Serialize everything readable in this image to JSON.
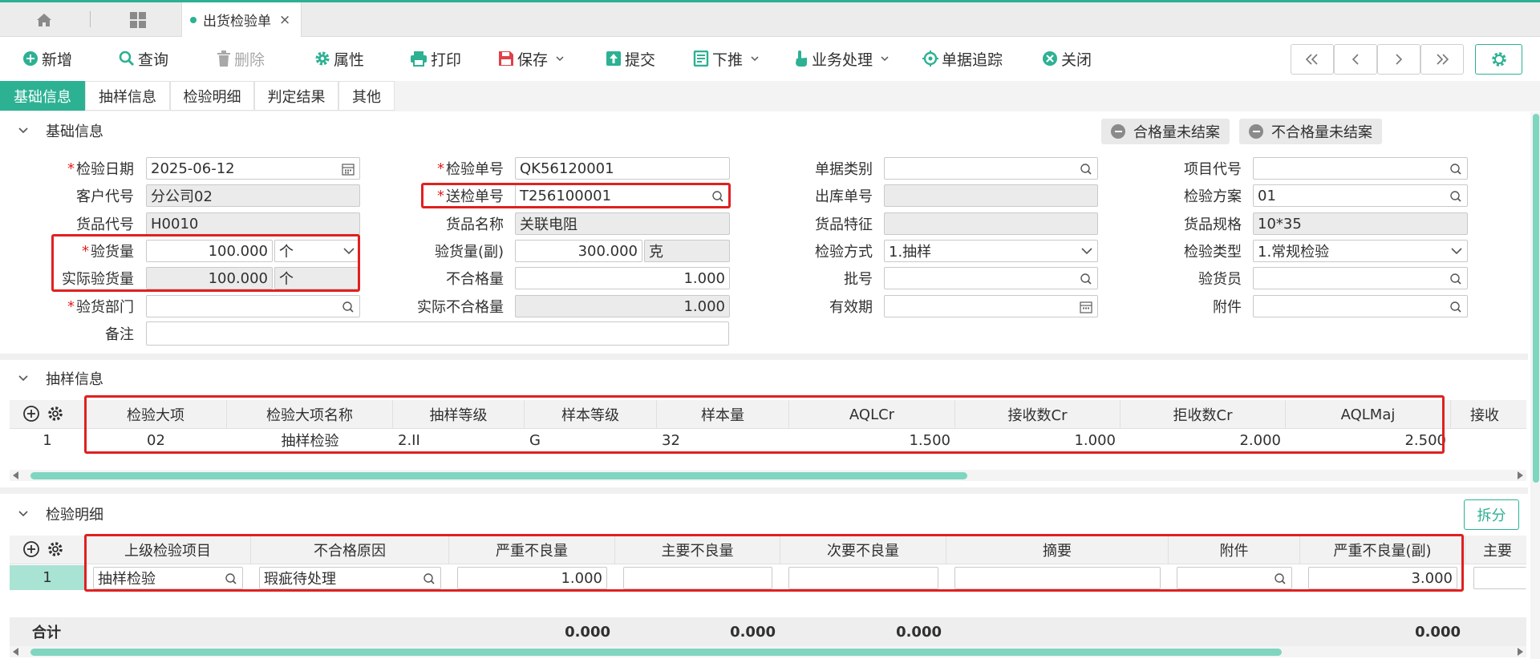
{
  "colors": {
    "accent": "#2cb193",
    "highlight": "#e02020",
    "selected_row": "#a8e3d3"
  },
  "tabs": {
    "doc_tab": "出货检验单",
    "close": "×"
  },
  "toolbar": {
    "new": "新增",
    "query": "查询",
    "delete": "删除",
    "props": "属性",
    "print": "打印",
    "save": "保存",
    "submit": "提交",
    "push_down": "下推",
    "business": "业务处理",
    "trace": "单据追踪",
    "close": "关闭"
  },
  "subtabs": [
    "基础信息",
    "抽样信息",
    "检验明细",
    "判定结果",
    "其他"
  ],
  "basic": {
    "section_title": "基础信息",
    "btn_pass_open": "合格量未结案",
    "btn_fail_open": "不合格量未结案",
    "required_mark": "*",
    "labels": {
      "inspect_date": "检验日期",
      "customer_code": "客户代号",
      "goods_code": "货品代号",
      "inspect_qty": "验货量",
      "actual_qty": "实际验货量",
      "dept": "验货部门",
      "remark": "备注",
      "inspect_no": "检验单号",
      "send_no": "送检单号",
      "goods_name": "货品名称",
      "qty_aux": "验货量(副)",
      "fail_qty": "不合格量",
      "actual_fail_qty": "实际不合格量",
      "doc_type": "单据类别",
      "outbound_no": "出库单号",
      "goods_feature": "货品特征",
      "inspect_method": "检验方式",
      "batch_no": "批号",
      "valid_date": "有效期",
      "project_code": "项目代号",
      "plan": "检验方案",
      "spec": "货品规格",
      "inspect_type": "检验类型",
      "inspector": "验货员",
      "attachment": "附件"
    },
    "values": {
      "inspect_date": "2025-06-12",
      "customer_code": "分公司02",
      "goods_code": "H0010",
      "inspect_qty": "100.000",
      "inspect_unit": "个",
      "actual_qty": "100.000",
      "actual_unit": "个",
      "dept": "",
      "remark": "",
      "inspect_no": "QK56120001",
      "send_no": "T256100001",
      "goods_name": "关联电阻",
      "qty_aux": "300.000",
      "aux_unit": "克",
      "fail_qty": "1.000",
      "actual_fail_qty": "1.000",
      "doc_type": "",
      "outbound_no": "",
      "goods_feature": "",
      "inspect_method": "1.抽样",
      "batch_no": "",
      "valid_date": "",
      "project_code": "",
      "plan": "01",
      "spec": "10*35",
      "inspect_type": "1.常规检验",
      "inspector": "",
      "attachment": ""
    }
  },
  "sampling": {
    "section_title": "抽样信息",
    "columns": [
      "检验大项",
      "检验大项名称",
      "抽样等级",
      "样本等级",
      "样本量",
      "AQLCr",
      "接收数Cr",
      "拒收数Cr",
      "AQLMaj",
      "接收"
    ],
    "rows": [
      {
        "idx": "1",
        "item": "02",
        "item_name": "抽样检验",
        "level": "2.II",
        "sample_level": "G",
        "sample_size": "32",
        "aql_cr": "1.500",
        "acc_cr": "1.000",
        "rej_cr": "2.000",
        "aql_maj": "2.500"
      }
    ]
  },
  "detail": {
    "section_title": "检验明细",
    "split": "拆分",
    "columns": [
      "上级检验项目",
      "不合格原因",
      "严重不良量",
      "主要不良量",
      "次要不良量",
      "摘要",
      "附件",
      "严重不良量(副)",
      "主要"
    ],
    "rows": [
      {
        "idx": "1",
        "parent": "抽样检验",
        "reason": "瑕疵待处理",
        "critical": "1.000",
        "major": "",
        "minor": "",
        "summary": "",
        "attachment": "",
        "critical_aux": "3.000"
      }
    ],
    "totals": {
      "label": "合计",
      "critical": "0.000",
      "major": "0.000",
      "minor": "0.000",
      "critical_aux": "0.000"
    }
  }
}
